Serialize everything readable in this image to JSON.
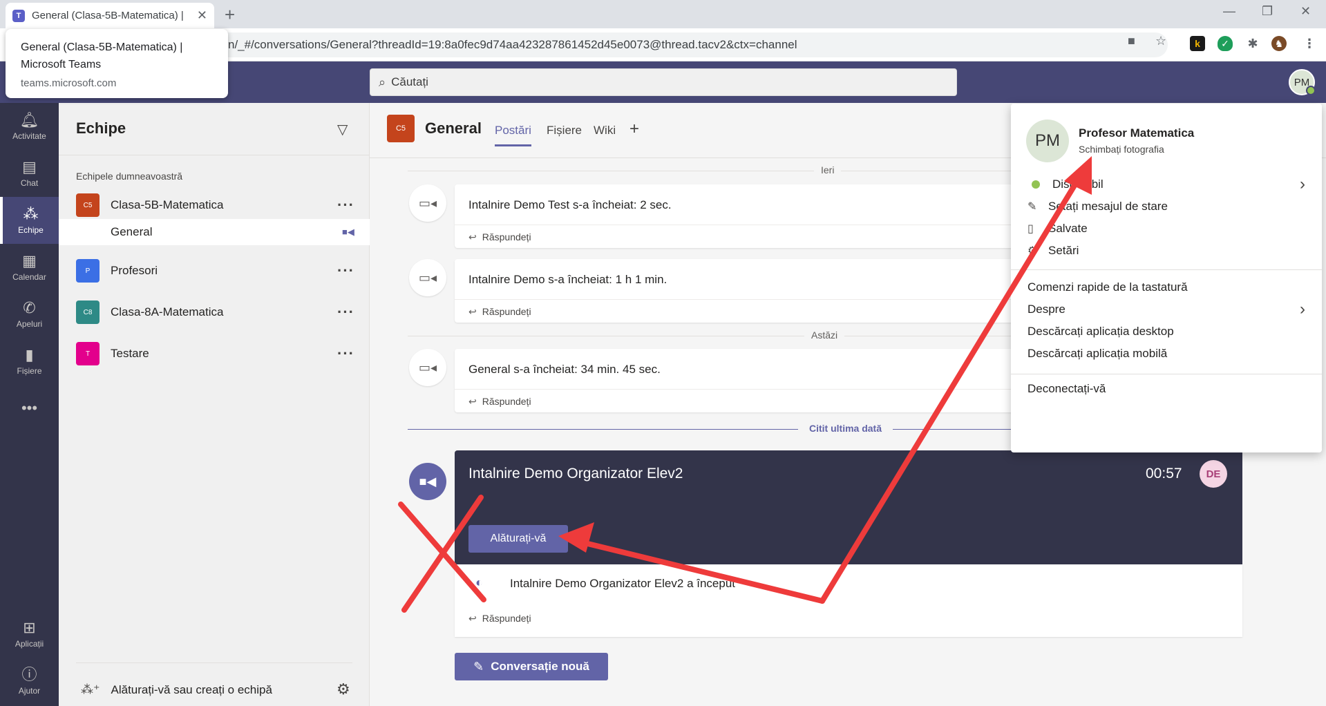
{
  "browser": {
    "tab_title": "General (Clasa-5B-Matematica) |",
    "url": "n/_#/conversations/General?threadId=19:8a0fec9d74aa423287861452d45e0073@thread.tacv2&ctx=channel",
    "tooltip_title": "General (Clasa-5B-Matematica) | Microsoft Teams",
    "tooltip_domain": "teams.microsoft.com"
  },
  "header": {
    "search_placeholder": "Căutați",
    "avatar_initials": "PM"
  },
  "rail": {
    "items": [
      {
        "label": "Activitate",
        "icon": "bell-icon"
      },
      {
        "label": "Chat",
        "icon": "chat-icon"
      },
      {
        "label": "Echipe",
        "icon": "teams-icon"
      },
      {
        "label": "Calendar",
        "icon": "calendar-icon"
      },
      {
        "label": "Apeluri",
        "icon": "phone-icon"
      },
      {
        "label": "Fișiere",
        "icon": "file-icon"
      }
    ],
    "more": "•••",
    "apps_label": "Aplicații",
    "help_label": "Ajutor"
  },
  "teams_pane": {
    "title": "Echipe",
    "section_label": "Echipele dumneavoastră",
    "teams": [
      {
        "initials": "C5",
        "name": "Clasa-5B-Matematica",
        "color": "#c4441c"
      },
      {
        "initials": "P",
        "name": "Profesori",
        "color": "#3b6fe5"
      },
      {
        "initials": "C8",
        "name": "Clasa-8A-Matematica",
        "color": "#2e8a86"
      },
      {
        "initials": "T",
        "name": "Testare",
        "color": "#e3008c"
      }
    ],
    "channel": "General",
    "join_label": "Alăturați-vă sau creați o echipă"
  },
  "channel_header": {
    "initials": "C5",
    "title": "General",
    "tabs": [
      "Postări",
      "Fișiere",
      "Wiki"
    ]
  },
  "feed": {
    "date_yesterday": "Ieri",
    "date_today": "Astăzi",
    "reply_label": "Răspundeți",
    "messages": [
      {
        "text": "Intalnire Demo Test s-a încheiat: 2 sec."
      },
      {
        "text": "Intalnire Demo s-a încheiat: 1 h 1 min."
      },
      {
        "text": "General s-a încheiat: 34 min. 45 sec."
      }
    ],
    "last_read": "Citit ultima dată",
    "meeting": {
      "title": "Intalnire Demo Organizator Elev2",
      "time": "00:57",
      "avatar": "DE",
      "join_label": "Alăturați-vă",
      "footer_text": "Intalnire Demo Organizator Elev2 a început"
    },
    "new_conversation": "Conversație nouă"
  },
  "profile_menu": {
    "initials": "PM",
    "name": "Profesor Matematica",
    "change_photo": "Schimbați fotografia",
    "status": "Disponibil",
    "set_status": "Setați mesajul de stare",
    "saved": "Salvate",
    "settings": "Setări",
    "shortcuts": "Comenzi rapide de la tastatură",
    "about": "Despre",
    "download_desktop": "Descărcați aplicația desktop",
    "download_mobile": "Descărcați aplicația mobilă",
    "sign_out": "Deconectați-vă"
  },
  "colors": {
    "brand": "#6264a7",
    "header": "#464775",
    "rail": "#33344a",
    "annotation": "#ee3b3b"
  }
}
